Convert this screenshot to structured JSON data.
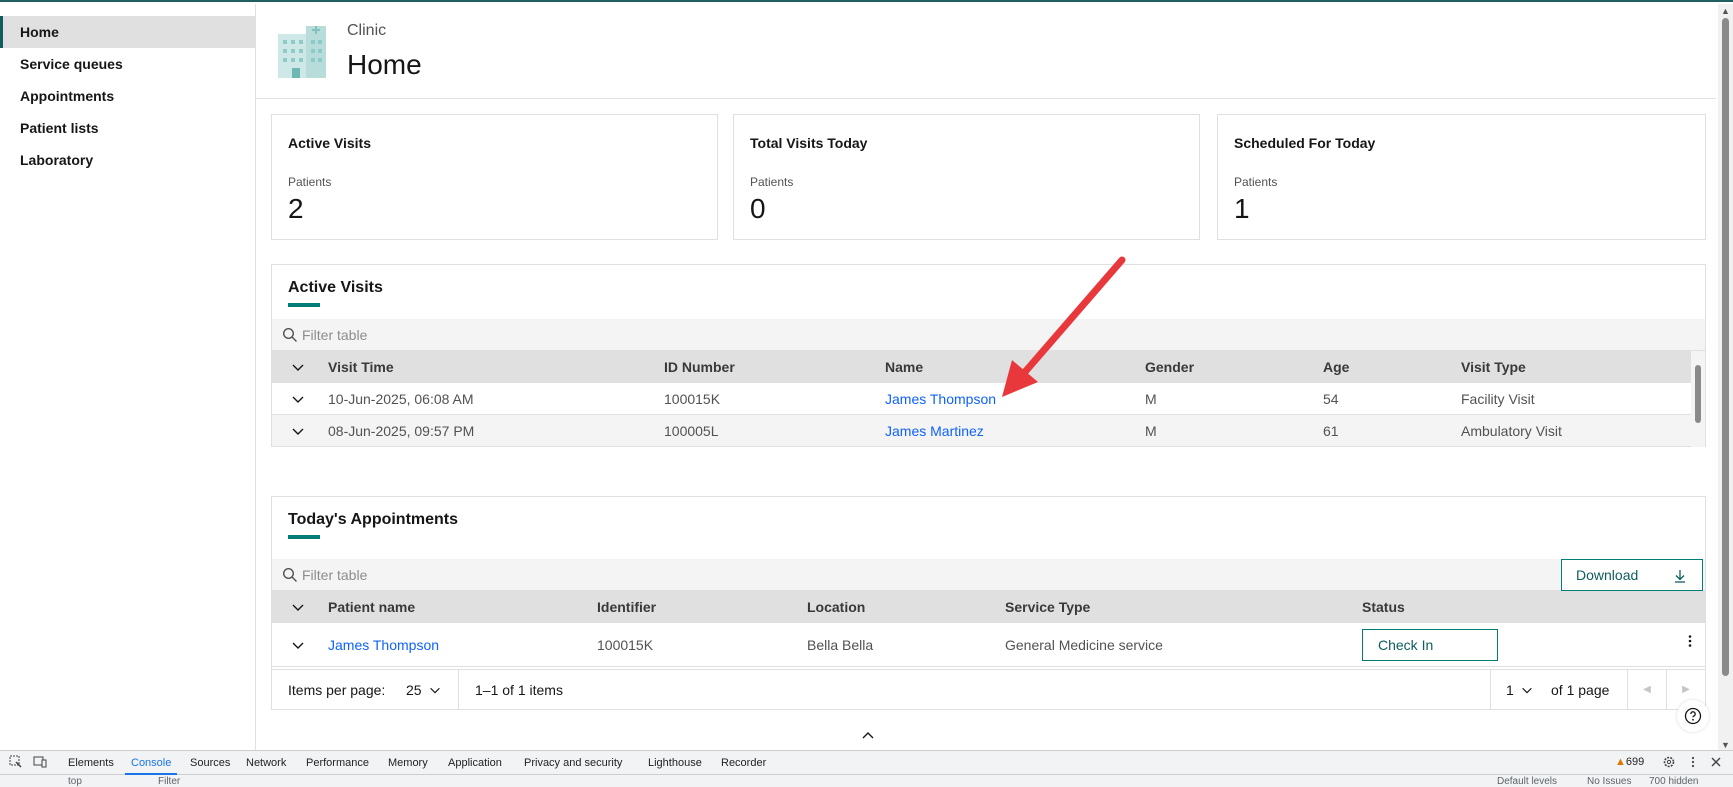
{
  "sidebar": {
    "items": [
      {
        "label": "Home",
        "active": true
      },
      {
        "label": "Service queues"
      },
      {
        "label": "Appointments"
      },
      {
        "label": "Patient lists"
      },
      {
        "label": "Laboratory"
      }
    ]
  },
  "header": {
    "subtitle": "Clinic",
    "title": "Home",
    "illustration": "hospital-building-icon"
  },
  "metrics": [
    {
      "title": "Active Visits",
      "label": "Patients",
      "value": "2"
    },
    {
      "title": "Total Visits Today",
      "label": "Patients",
      "value": "0"
    },
    {
      "title": "Scheduled For Today",
      "label": "Patients",
      "value": "1"
    }
  ],
  "active_visits": {
    "title": "Active Visits",
    "filter_placeholder": "Filter table",
    "columns": [
      "Visit Time",
      "ID Number",
      "Name",
      "Gender",
      "Age",
      "Visit Type"
    ],
    "rows": [
      {
        "visit_time": "10-Jun-2025, 06:08 AM",
        "id": "100015K",
        "name": "James Thompson",
        "gender": "M",
        "age": "54",
        "visit_type": "Facility Visit"
      },
      {
        "visit_time": "08-Jun-2025, 09:57 PM",
        "id": "100005L",
        "name": "James Martinez",
        "gender": "M",
        "age": "61",
        "visit_type": "Ambulatory Visit"
      }
    ]
  },
  "appointments": {
    "title": "Today's Appointments",
    "filter_placeholder": "Filter table",
    "download_label": "Download",
    "columns": [
      "Patient name",
      "Identifier",
      "Location",
      "Service Type",
      "Status"
    ],
    "rows": [
      {
        "patient_name": "James Thompson",
        "identifier": "100015K",
        "location": "Bella Bella",
        "service_type": "General Medicine service",
        "action": "Check In"
      }
    ],
    "pagination": {
      "items_per_page_label": "Items per page:",
      "items_per_page": "25",
      "range": "1–1 of 1 items",
      "page": "1",
      "of_pages": "of 1 page"
    }
  },
  "devtools": {
    "tabs": [
      "Elements",
      "Console",
      "Sources",
      "Network",
      "Performance",
      "Memory",
      "Application",
      "Privacy and security",
      "Lighthouse",
      "Recorder"
    ],
    "active_tab": "Console",
    "warning_count": "699",
    "row2": {
      "context": "top",
      "filter": "Filter",
      "levels": "Default levels",
      "issues": "No Issues",
      "hidden": "700 hidden"
    }
  },
  "colors": {
    "accent": "#007d79",
    "link": "#0f62fe",
    "annotation": "#e8383b"
  }
}
